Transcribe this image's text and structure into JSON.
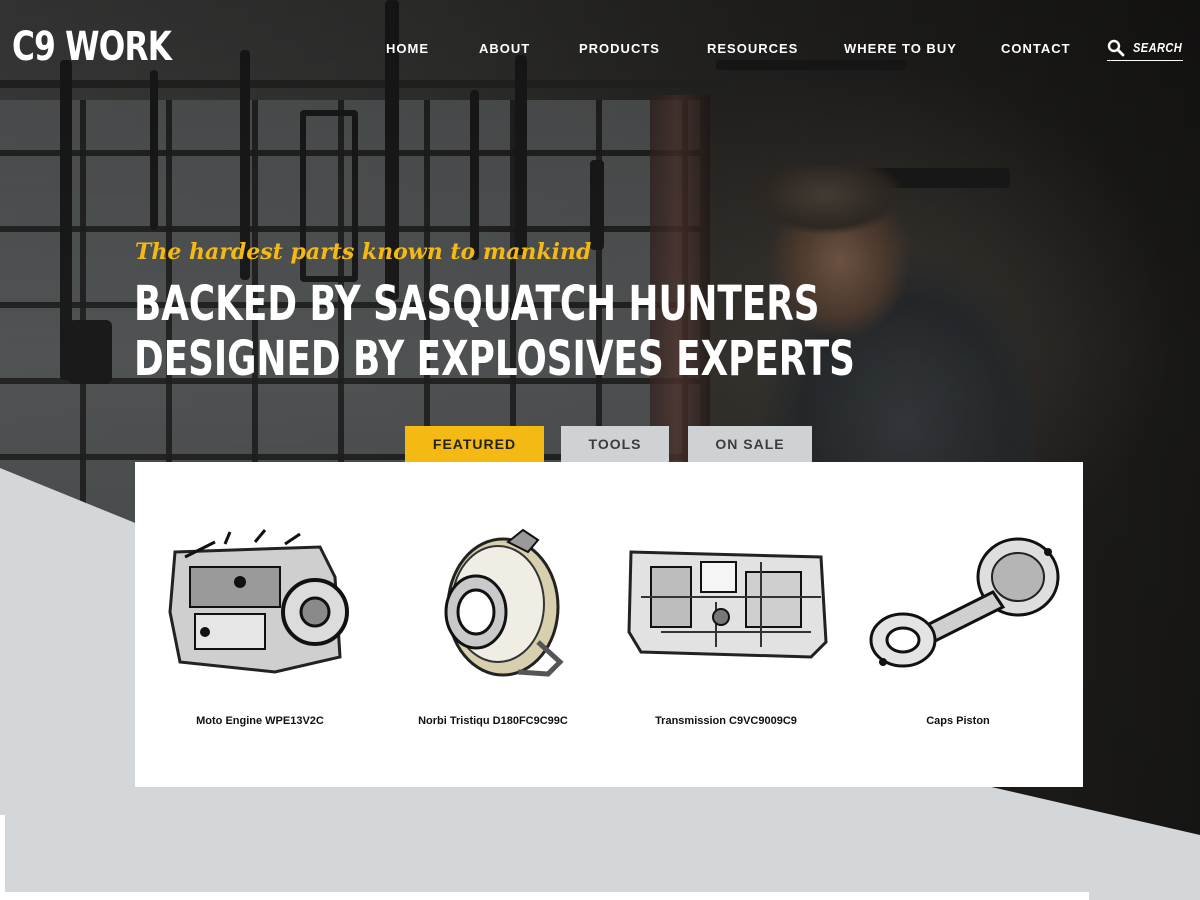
{
  "brand": {
    "logo": "C9 WORK"
  },
  "nav": {
    "items": [
      {
        "label": "HOME"
      },
      {
        "label": "ABOUT"
      },
      {
        "label": "PRODUCTS"
      },
      {
        "label": "RESOURCES"
      },
      {
        "label": "WHERE TO BUY"
      },
      {
        "label": "CONTACT"
      }
    ],
    "search_label": "SEARCH",
    "search_icon": "search-icon"
  },
  "hero": {
    "tagline": "The hardest parts known to mankind",
    "headline_line1": "BACKED BY SASQUATCH HUNTERS",
    "headline_line2": "DESIGNED BY EXPLOSIVES EXPERTS"
  },
  "tabs": [
    {
      "label": "FEATURED",
      "active": true
    },
    {
      "label": "TOOLS",
      "active": false
    },
    {
      "label": "ON SALE",
      "active": false
    }
  ],
  "products": [
    {
      "name": "Moto Engine WPE13V2C",
      "icon": "engine-image"
    },
    {
      "name": "Norbi Tristiqu D180FC9C99C",
      "icon": "clutch-image"
    },
    {
      "name": "Transmission C9VC9009C9",
      "icon": "transmission-image"
    },
    {
      "name": "Caps Piston",
      "icon": "piston-image"
    }
  ],
  "colors": {
    "accent": "#f4b913",
    "tab_inactive": "#cfd2d4",
    "panel": "#ffffff",
    "page_background": "#d3d7da"
  }
}
